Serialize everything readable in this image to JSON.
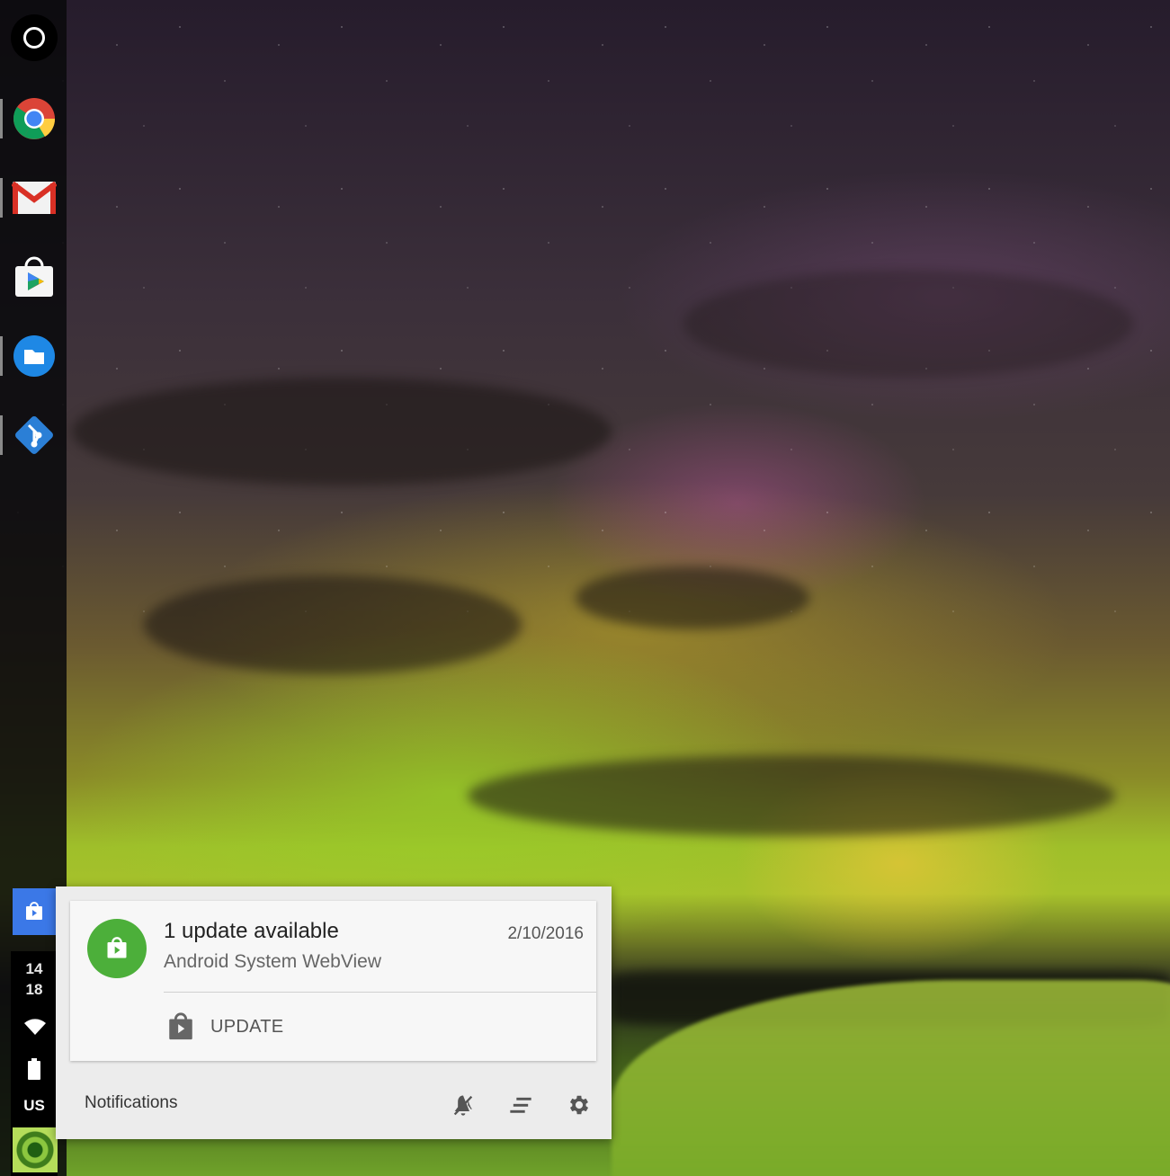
{
  "shelf": {
    "launcher": {
      "icon": "launcher-icon"
    },
    "apps": [
      {
        "name": "Chrome",
        "icon": "chrome-icon",
        "running": true
      },
      {
        "name": "Gmail",
        "icon": "gmail-icon",
        "running": true
      },
      {
        "name": "Play Store",
        "icon": "play-store-icon",
        "running": false
      },
      {
        "name": "Files",
        "icon": "files-icon",
        "running": true
      },
      {
        "name": "Git",
        "icon": "git-icon",
        "running": true
      }
    ]
  },
  "status_area": {
    "notification_icon": "play-store-bag-icon",
    "clock_hour": "14",
    "clock_minute": "18",
    "wifi_icon": "wifi-icon",
    "battery_icon": "battery-icon",
    "ime": "US",
    "avatar_icon": "user-avatar"
  },
  "notification_center": {
    "notification": {
      "title": "1 update available",
      "subtitle": "Android System WebView",
      "date": "2/10/2016",
      "action_label": "UPDATE",
      "app_icon": "play-store-bag-icon",
      "app_color": "#4caf3a"
    },
    "footer": {
      "label": "Notifications",
      "do_not_disturb_icon": "do-not-disturb-icon",
      "clear_all_icon": "clear-all-icon",
      "settings_icon": "settings-gear-icon"
    }
  },
  "colors": {
    "shelf_bg": "#0a0a0c",
    "accent_blue": "#3b78e7",
    "notification_green": "#4caf3a"
  }
}
